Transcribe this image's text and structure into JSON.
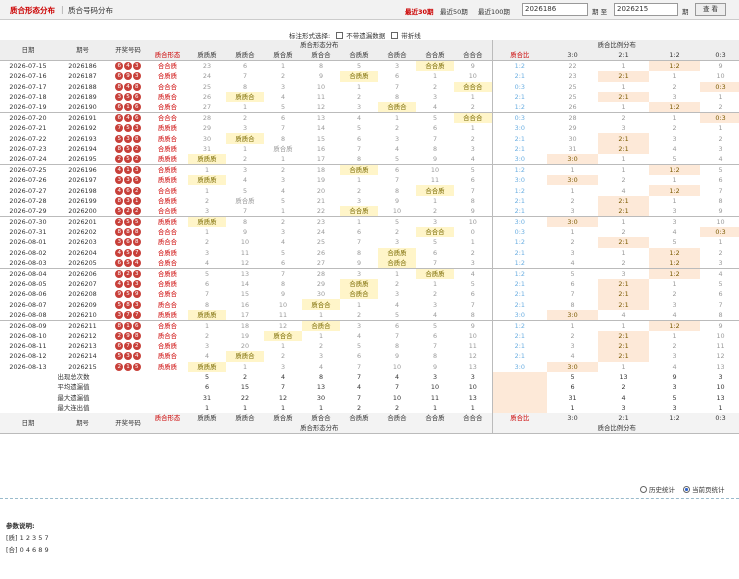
{
  "topbar": {
    "tab_active": "质合形态分布",
    "tab_sep": "|",
    "tab_other": "质合号码分布",
    "quick": [
      "最近30期",
      "最近50期",
      "最近100期"
    ],
    "start": "2026186",
    "to": "期 至",
    "end": "2026215",
    "period": "期",
    "query": "查 看"
  },
  "filter": {
    "label": "标注形式选择:",
    "opt1": "不带遗漏数据",
    "opt2": "带折线"
  },
  "header": {
    "date": "日期",
    "issue": "期号",
    "draw": "开奖号码",
    "group1": "质合形态分布",
    "group2": "质合比例分布",
    "form_col": "质合形态",
    "forms": [
      "质质质",
      "质质合",
      "质合质",
      "质合合",
      "合质质",
      "合质合",
      "合合质",
      "合合合"
    ],
    "ratio_col": "质合比",
    "ratios": [
      "3:0",
      "2:1",
      "1:2",
      "0:3"
    ]
  },
  "rows": [
    {
      "d": "2026-07-15",
      "i": "2026186",
      "b": "643",
      "f": "合合质",
      "c": [
        "23",
        "6",
        "1",
        "8",
        "5",
        "3",
        "合合质",
        "9"
      ],
      "rt": "1:2",
      "rc": [
        "22",
        "1",
        "1:2",
        "9"
      ]
    },
    {
      "d": "2026-07-16",
      "i": "2026187",
      "b": "693",
      "f": "合质质",
      "c": [
        "24",
        "7",
        "2",
        "9",
        "合质质",
        "6",
        "1",
        "10"
      ],
      "rt": "2:1",
      "rc": [
        "23",
        "2:1",
        "1",
        "10"
      ]
    },
    {
      "d": "2026-07-17",
      "i": "2026188",
      "b": "848",
      "f": "合合合",
      "c": [
        "25",
        "8",
        "3",
        "10",
        "1",
        "7",
        "2",
        "合合合"
      ],
      "rt": "0:3",
      "rc": [
        "25",
        "1",
        "2",
        "0:3"
      ]
    },
    {
      "d": "2026-07-18",
      "i": "2026189",
      "b": "356",
      "f": "质质合",
      "c": [
        "26",
        "质质合",
        "4",
        "11",
        "2",
        "8",
        "3",
        "1"
      ],
      "rt": "2:1",
      "rc": [
        "25",
        "2:1",
        "3",
        "1"
      ]
    },
    {
      "d": "2026-07-19",
      "i": "2026190",
      "b": "616",
      "f": "合质合",
      "c": [
        "27",
        "1",
        "5",
        "12",
        "3",
        "合质合",
        "4",
        "2"
      ],
      "rt": "1:2",
      "rc": [
        "26",
        "1",
        "1:2",
        "2"
      ]
    },
    {
      "d": "2026-07-20",
      "i": "2026191",
      "b": "646",
      "f": "合合合",
      "c": [
        "28",
        "2",
        "6",
        "13",
        "4",
        "1",
        "5",
        "合合合"
      ],
      "rt": "0:3",
      "rc": [
        "28",
        "2",
        "1",
        "0:3"
      ]
    },
    {
      "d": "2026-07-21",
      "i": "2026192",
      "b": "753",
      "f": "质质质",
      "c": [
        "29",
        "3",
        "7",
        "14",
        "5",
        "2",
        "6",
        "1"
      ],
      "rt": "3:0",
      "rc": [
        "29",
        "3",
        "2",
        "1"
      ]
    },
    {
      "d": "2026-07-22",
      "i": "2026193",
      "b": "538",
      "f": "质质合",
      "c": [
        "30",
        "质质合",
        "8",
        "15",
        "6",
        "3",
        "7",
        "2"
      ],
      "rt": "2:1",
      "rc": [
        "30",
        "2:1",
        "3",
        "2"
      ]
    },
    {
      "d": "2026-07-23",
      "i": "2026194",
      "b": "852",
      "f": "合质质",
      "c": [
        "31",
        "1",
        "质合质",
        "16",
        "7",
        "4",
        "8",
        "3"
      ],
      "rt": "2:1",
      "rc": [
        "31",
        "2:1",
        "4",
        "3"
      ]
    },
    {
      "d": "2026-07-24",
      "i": "2026195",
      "b": "252",
      "f": "质质质",
      "c": [
        "质质质",
        "2",
        "1",
        "17",
        "8",
        "5",
        "9",
        "4"
      ],
      "rt": "3:0",
      "rc": [
        "3:0",
        "1",
        "5",
        "4"
      ]
    },
    {
      "d": "2026-07-25",
      "i": "2026196",
      "b": "413",
      "f": "合质质",
      "c": [
        "1",
        "3",
        "2",
        "18",
        "合质质",
        "6",
        "10",
        "5"
      ],
      "rt": "1:2",
      "rc": [
        "1",
        "1",
        "1:2",
        "5"
      ]
    },
    {
      "d": "2026-07-26",
      "i": "2026197",
      "b": "335",
      "f": "质质质",
      "c": [
        "质质质",
        "4",
        "3",
        "19",
        "1",
        "7",
        "11",
        "6"
      ],
      "rt": "3:0",
      "rc": [
        "3:0",
        "2",
        "1",
        "6"
      ]
    },
    {
      "d": "2026-07-27",
      "i": "2026198",
      "b": "462",
      "f": "合合质",
      "c": [
        "1",
        "5",
        "4",
        "20",
        "2",
        "8",
        "合合质",
        "7"
      ],
      "rt": "1:2",
      "rc": [
        "1",
        "4",
        "1:2",
        "7"
      ]
    },
    {
      "d": "2026-07-28",
      "i": "2026199",
      "b": "831",
      "f": "合质质",
      "c": [
        "2",
        "质合质",
        "5",
        "21",
        "3",
        "9",
        "1",
        "8"
      ],
      "rt": "2:1",
      "rc": [
        "2",
        "2:1",
        "1",
        "8"
      ]
    },
    {
      "d": "2026-07-29",
      "i": "2026200",
      "b": "522",
      "f": "合合质",
      "c": [
        "3",
        "7",
        "1",
        "22",
        "合合质",
        "10",
        "2",
        "9"
      ],
      "rt": "2:1",
      "rc": [
        "3",
        "2:1",
        "3",
        "9"
      ]
    },
    {
      "d": "2026-07-30",
      "i": "2026201",
      "b": "255",
      "f": "质质质",
      "c": [
        "质质质",
        "8",
        "2",
        "23",
        "1",
        "5",
        "3",
        "10"
      ],
      "rt": "3:0",
      "rc": [
        "3:0",
        "1",
        "3",
        "10"
      ]
    },
    {
      "d": "2026-07-31",
      "i": "2026202",
      "b": "888",
      "f": "合合合",
      "c": [
        "1",
        "9",
        "3",
        "24",
        "6",
        "2",
        "合合合",
        "0"
      ],
      "rt": "0:3",
      "rc": [
        "1",
        "2",
        "4",
        "0:3"
      ]
    },
    {
      "d": "2026-08-01",
      "i": "2026203",
      "b": "368",
      "f": "质合合",
      "c": [
        "2",
        "10",
        "4",
        "25",
        "7",
        "3",
        "5",
        "1"
      ],
      "rt": "1:2",
      "rc": [
        "2",
        "2:1",
        "5",
        "1"
      ]
    },
    {
      "d": "2026-08-02",
      "i": "2026204",
      "b": "457",
      "f": "合质质",
      "c": [
        "3",
        "11",
        "5",
        "26",
        "8",
        "合质质",
        "6",
        "2"
      ],
      "rt": "2:1",
      "rc": [
        "3",
        "1",
        "1:2",
        "2"
      ]
    },
    {
      "d": "2026-08-03",
      "i": "2026205",
      "b": "654",
      "f": "合质合",
      "c": [
        "4",
        "12",
        "6",
        "27",
        "9",
        "合质合",
        "7",
        "3"
      ],
      "rt": "1:2",
      "rc": [
        "4",
        "2",
        "1:2",
        "3"
      ]
    },
    {
      "d": "2026-08-04",
      "i": "2026206",
      "b": "823",
      "f": "合质质",
      "c": [
        "5",
        "13",
        "7",
        "28",
        "3",
        "1",
        "合质质",
        "4"
      ],
      "rt": "1:2",
      "rc": [
        "5",
        "3",
        "1:2",
        "4"
      ]
    },
    {
      "d": "2026-08-05",
      "i": "2026207",
      "b": "413",
      "f": "合质质",
      "c": [
        "6",
        "14",
        "8",
        "29",
        "合质质",
        "2",
        "1",
        "5"
      ],
      "rt": "2:1",
      "rc": [
        "6",
        "2:1",
        "1",
        "5"
      ]
    },
    {
      "d": "2026-08-06",
      "i": "2026208",
      "b": "959",
      "f": "合质合",
      "c": [
        "7",
        "15",
        "9",
        "30",
        "合质合",
        "3",
        "2",
        "6"
      ],
      "rt": "2:1",
      "rc": [
        "7",
        "2:1",
        "2",
        "6"
      ]
    },
    {
      "d": "2026-08-07",
      "i": "2026209",
      "b": "583",
      "f": "质合合",
      "c": [
        "8",
        "16",
        "10",
        "质合合",
        "1",
        "4",
        "3",
        "7"
      ],
      "rt": "2:1",
      "rc": [
        "8",
        "2:1",
        "3",
        "7"
      ]
    },
    {
      "d": "2026-08-08",
      "i": "2026210",
      "b": "377",
      "f": "质质质",
      "c": [
        "质质质",
        "17",
        "11",
        "1",
        "2",
        "5",
        "4",
        "8"
      ],
      "rt": "3:0",
      "rc": [
        "3:0",
        "4",
        "4",
        "8"
      ]
    },
    {
      "d": "2026-08-09",
      "i": "2026211",
      "b": "816",
      "f": "合质合",
      "c": [
        "1",
        "18",
        "12",
        "合质合",
        "3",
        "6",
        "5",
        "9"
      ],
      "rt": "1:2",
      "rc": [
        "1",
        "1",
        "1:2",
        "9"
      ]
    },
    {
      "d": "2026-08-10",
      "i": "2026212",
      "b": "298",
      "f": "质合合",
      "c": [
        "2",
        "19",
        "质合合",
        "1",
        "4",
        "7",
        "6",
        "10"
      ],
      "rt": "2:1",
      "rc": [
        "2",
        "2:1",
        "1",
        "10"
      ]
    },
    {
      "d": "2026-08-11",
      "i": "2026213",
      "b": "672",
      "f": "合质质",
      "c": [
        "3",
        "20",
        "1",
        "2",
        "5",
        "8",
        "7",
        "11"
      ],
      "rt": "2:1",
      "rc": [
        "3",
        "2:1",
        "2",
        "11"
      ]
    },
    {
      "d": "2026-08-12",
      "i": "2026214",
      "b": "534",
      "f": "质质合",
      "c": [
        "4",
        "质质合",
        "2",
        "3",
        "6",
        "9",
        "8",
        "12"
      ],
      "rt": "2:1",
      "rc": [
        "4",
        "2:1",
        "3",
        "12"
      ]
    },
    {
      "d": "2026-08-13",
      "i": "2026215",
      "b": "215",
      "f": "质质质",
      "c": [
        "质质质",
        "1",
        "3",
        "4",
        "7",
        "10",
        "9",
        "13"
      ],
      "rt": "3:0",
      "rc": [
        "3:0",
        "1",
        "4",
        "13"
      ]
    }
  ],
  "stats": [
    {
      "label": "出现总次数",
      "c": [
        "5",
        "2",
        "4",
        "8",
        "7",
        "4",
        "3",
        "3"
      ],
      "r": [
        "5",
        "13",
        "9",
        "3"
      ]
    },
    {
      "label": "平均遗漏值",
      "c": [
        "6",
        "15",
        "7",
        "13",
        "4",
        "7",
        "10",
        "10"
      ],
      "r": [
        "6",
        "2",
        "3",
        "10"
      ]
    },
    {
      "label": "最大遗漏值",
      "c": [
        "31",
        "22",
        "12",
        "30",
        "7",
        "10",
        "11",
        "13"
      ],
      "r": [
        "31",
        "4",
        "5",
        "13"
      ]
    },
    {
      "label": "最大连出值",
      "c": [
        "1",
        "1",
        "1",
        "1",
        "2",
        "2",
        "1",
        "1"
      ],
      "r": [
        "1",
        "3",
        "3",
        "1"
      ]
    }
  ],
  "footer": {
    "radio1": "历史统计",
    "radio2": "当前页统计",
    "notes_title": "参数说明:",
    "note1": "[质] 1 2 3 5 7",
    "note2": "[合] 0 4 6 8 9"
  },
  "colors": {
    "accent": "#cc0000",
    "ball": "#c8403a",
    "hit": "#fff5c9",
    "ratio_hit": "#fde9d8"
  }
}
